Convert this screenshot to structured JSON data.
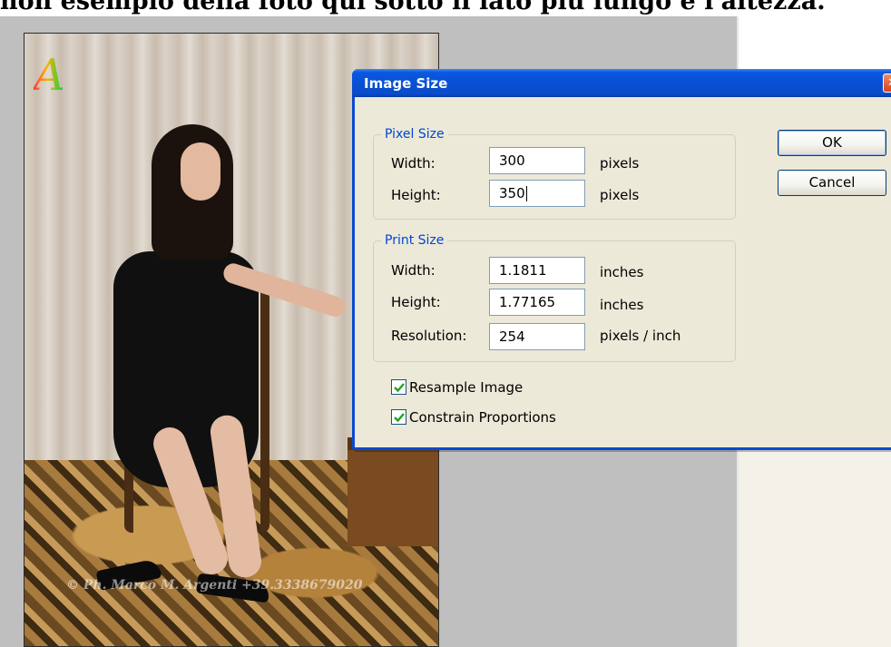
{
  "caption": "non esempio della foto qui sotto il lato più lungo è l'altezza.",
  "photo": {
    "watermark": "© Ph. Marco M. Argenti +39.3338679020"
  },
  "dialog": {
    "title": "Image Size",
    "close_glyph": "✕",
    "pixel_size": {
      "legend": "Pixel Size",
      "width_label": "Width:",
      "width_value": "300",
      "width_unit": "pixels",
      "height_label": "Height:",
      "height_value": "350",
      "height_unit": "pixels"
    },
    "print_size": {
      "legend": "Print Size",
      "width_label": "Width:",
      "width_value": "1.1811",
      "width_unit": "inches",
      "height_label": "Height:",
      "height_value": "1.77165",
      "height_unit": "inches",
      "resolution_label": "Resolution:",
      "resolution_value": "254",
      "resolution_unit": "pixels / inch"
    },
    "resample_label": "Resample Image",
    "resample_checked": true,
    "constrain_label": "Constrain Proportions",
    "constrain_checked": true,
    "ok_label": "OK",
    "cancel_label": "Cancel"
  },
  "colors": {
    "titlebar": "#0a58e0",
    "dialog_bg": "#ece9d8",
    "legend_text": "#0046d5",
    "canvas_bg": "#bfbfbf",
    "check_mark": "#21a121"
  }
}
